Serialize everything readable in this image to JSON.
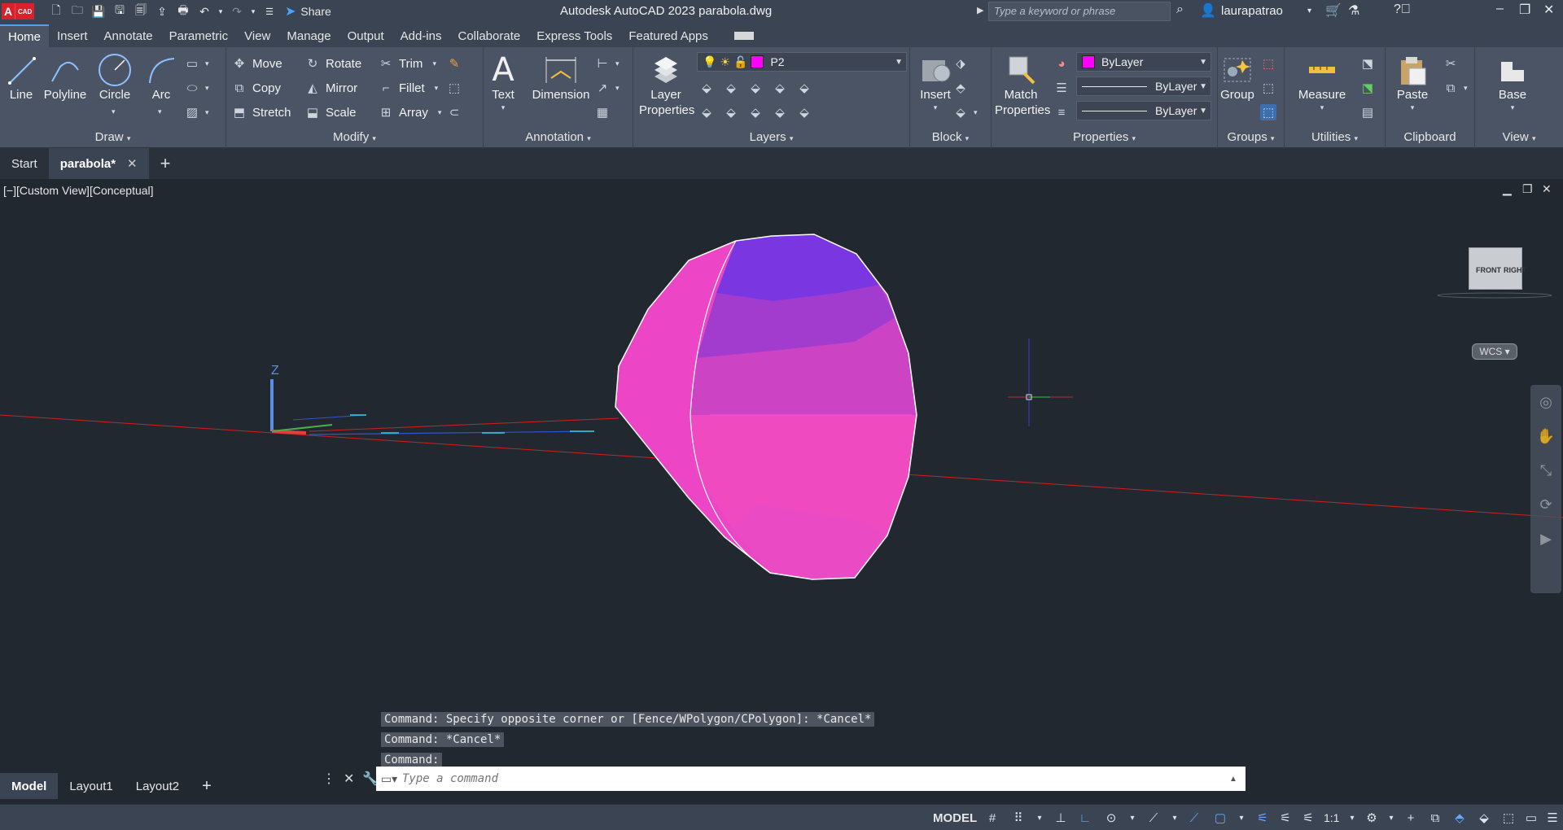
{
  "titlebar": {
    "app_logo_letter": "A",
    "app_logo_text": "CAD",
    "share_label": "Share",
    "title": "Autodesk AutoCAD 2023    parabola.dwg",
    "search_placeholder": "Type a keyword or phrase",
    "user_name": "laurapatrao"
  },
  "ribbon_tabs": [
    "Home",
    "Insert",
    "Annotate",
    "Parametric",
    "View",
    "Manage",
    "Output",
    "Add-ins",
    "Collaborate",
    "Express Tools",
    "Featured Apps"
  ],
  "panels": {
    "draw": {
      "title": "Draw",
      "tools": [
        "Line",
        "Polyline",
        "Circle",
        "Arc"
      ]
    },
    "modify": {
      "title": "Modify",
      "tools": [
        "Move",
        "Rotate",
        "Trim",
        "Copy",
        "Mirror",
        "Fillet",
        "Stretch",
        "Scale",
        "Array"
      ]
    },
    "annotation": {
      "title": "Annotation",
      "tools": [
        "Text",
        "Dimension"
      ]
    },
    "layers": {
      "title": "Layers",
      "tool": "Layer Properties",
      "current_layer": "P2",
      "layer_color": "#ff00ff"
    },
    "block": {
      "title": "Block",
      "tool": "Insert"
    },
    "properties": {
      "title": "Properties",
      "tool": "Match Properties",
      "color_value": "ByLayer",
      "lineweight_value": "ByLayer",
      "linetype_value": "ByLayer"
    },
    "groups": {
      "title": "Groups",
      "tool": "Group"
    },
    "utilities": {
      "title": "Utilities",
      "tool": "Measure"
    },
    "clipboard": {
      "title": "Clipboard",
      "tool": "Paste"
    },
    "view": {
      "title": "View",
      "tool": "Base"
    }
  },
  "file_tabs": [
    {
      "label": "Start",
      "active": false
    },
    {
      "label": "parabola*",
      "active": true
    }
  ],
  "viewport": {
    "label": "[−][Custom View][Conceptual]",
    "viewcube_front": "FRONT",
    "viewcube_right": "RIGHT",
    "wcs_label": "WCS",
    "ucs_z_label": "Z",
    "model_color": "#e84dc0"
  },
  "command_history": [
    "Command: Specify opposite corner or [Fence/WPolygon/CPolygon]: *Cancel*",
    "Command: *Cancel*",
    "Command:"
  ],
  "command_input_placeholder": "Type a command",
  "layout_tabs": [
    {
      "label": "Model",
      "active": true
    },
    {
      "label": "Layout1",
      "active": false
    },
    {
      "label": "Layout2",
      "active": false
    }
  ],
  "statusbar": {
    "model_label": "MODEL",
    "annotation_scale": "1:1"
  }
}
